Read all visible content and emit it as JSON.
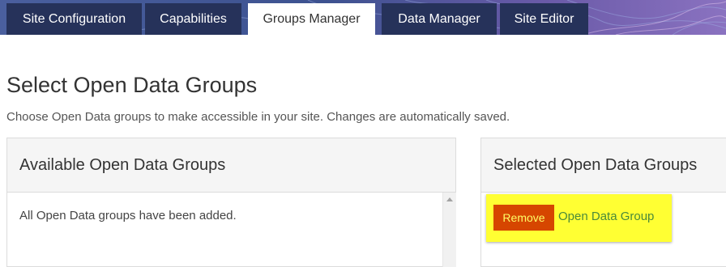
{
  "tabs": [
    {
      "label": "Site Configuration",
      "active": false
    },
    {
      "label": "Capabilities",
      "active": false
    },
    {
      "label": "Groups Manager",
      "active": true
    },
    {
      "label": "Data Manager",
      "active": false
    },
    {
      "label": "Site Editor",
      "active": false
    }
  ],
  "header": {
    "title": "Select Open Data Groups",
    "subtitle": "Choose Open Data groups to make accessible in your site. Changes are automatically saved."
  },
  "available_panel": {
    "title": "Available Open Data Groups",
    "empty_message": "All Open Data groups have been added."
  },
  "selected_panel": {
    "title": "Selected Open Data Groups",
    "items": [
      {
        "remove_label": "Remove",
        "name": "Open Data Group"
      }
    ]
  },
  "colors": {
    "tab_bg": "#26325a",
    "tab_active_bg": "#ffffff",
    "remove_button": "#d64600",
    "remove_text": "#ffff66",
    "highlight": "#ffff33",
    "group_link": "#4a8a3a"
  }
}
